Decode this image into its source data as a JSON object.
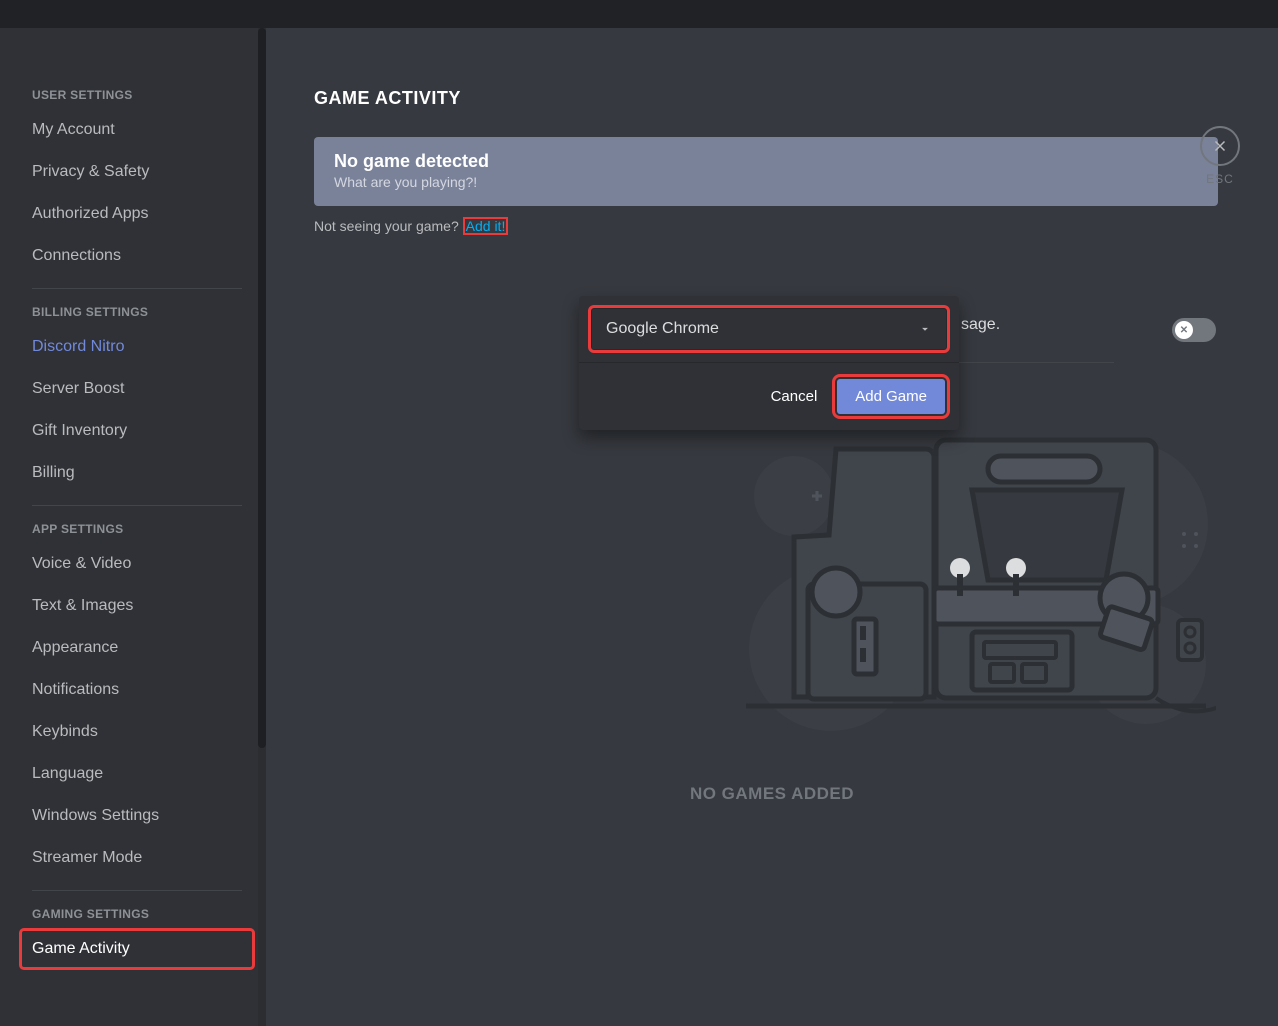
{
  "sidebar": {
    "sections": [
      {
        "header": "USER SETTINGS",
        "items": [
          {
            "label": "My Account"
          },
          {
            "label": "Privacy & Safety"
          },
          {
            "label": "Authorized Apps"
          },
          {
            "label": "Connections"
          }
        ]
      },
      {
        "header": "BILLING SETTINGS",
        "items": [
          {
            "label": "Discord Nitro",
            "accent": true
          },
          {
            "label": "Server Boost"
          },
          {
            "label": "Gift Inventory"
          },
          {
            "label": "Billing"
          }
        ]
      },
      {
        "header": "APP SETTINGS",
        "items": [
          {
            "label": "Voice & Video"
          },
          {
            "label": "Text & Images"
          },
          {
            "label": "Appearance"
          },
          {
            "label": "Notifications"
          },
          {
            "label": "Keybinds"
          },
          {
            "label": "Language"
          },
          {
            "label": "Windows Settings"
          },
          {
            "label": "Streamer Mode"
          }
        ]
      },
      {
        "header": "GAMING SETTINGS",
        "items": [
          {
            "label": "Game Activity",
            "active": true,
            "highlight": true
          }
        ]
      }
    ]
  },
  "main": {
    "title": "GAME ACTIVITY",
    "banner": {
      "title": "No game detected",
      "subtitle": "What are you playing?!"
    },
    "hint_prefix": "Not seeing your game? ",
    "hint_link": "Add it!",
    "toggle_text_fragment": "sage.",
    "popover": {
      "select_value": "Google Chrome",
      "cancel_label": "Cancel",
      "confirm_label": "Add Game"
    },
    "empty_state": "NO GAMES ADDED",
    "close_label": "ESC"
  }
}
